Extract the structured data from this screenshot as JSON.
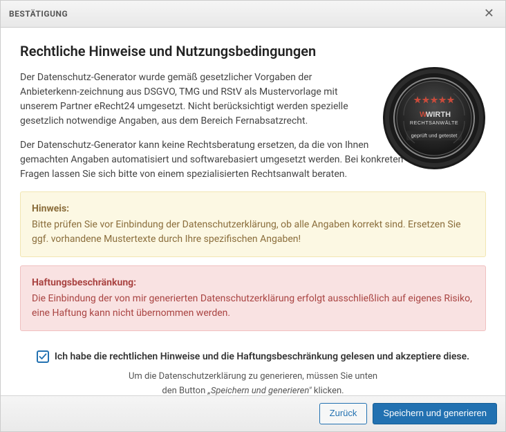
{
  "header": {
    "title": "BESTÄTIGUNG"
  },
  "heading": "Rechtliche Hinweise und Nutzungsbedingungen",
  "paragraph1": "Der Datenschutz-Generator wurde gemäß gesetzlicher Vorgaben der Anbieterkenn-zeichnung aus DSGVO, TMG und RStV als Mustervorlage mit unserem Partner eRecht24 umgesetzt. Nicht berücksichtigt werden spezielle gesetzlich notwendige Angaben, aus dem Bereich Fernabsatzrecht.",
  "paragraph2": "Der Datenschutz-Generator kann keine Rechtsberatung ersetzen, da die von Ihnen gemachten Angaben automatisiert und softwarebasiert umgesetzt werden. Bei konkreten Fragen lassen Sie sich bitte von einem spezialisierten Rechtsanwalt beraten.",
  "alert_hint": {
    "title": "Hinweis:",
    "text": "Bitte prüfen Sie vor Einbindung der Datenschutzerklärung, ob alle Angaben korrekt sind. Ersetzen Sie ggf. vorhandene Mustertexte durch Ihre spezifischen Angaben!"
  },
  "alert_liability": {
    "title": "Haftungsbeschränkung:",
    "text": "Die Einbindung der von mir generierten Datenschutzerklärung erfolgt ausschließlich auf eigenes Risiko, eine Haftung kann nicht übernommen werden."
  },
  "accept": {
    "checked": true,
    "label": "Ich habe die rechtlichen Hinweise und die Haftungsbeschränkung gelesen und akzeptiere diese."
  },
  "note": {
    "line1": "Um die Datenschutzerklärung zu generieren, müssen Sie unten",
    "line2_pre": "den Button ",
    "line2_em": "„Speichern und generieren\"",
    "line2_post": " klicken."
  },
  "seal": {
    "brand": "WIRTH",
    "subtitle": "RECHTSANWÄLTE",
    "caption": "geprüft und getestet"
  },
  "footer": {
    "back": "Zurück",
    "save": "Speichern und generieren"
  }
}
